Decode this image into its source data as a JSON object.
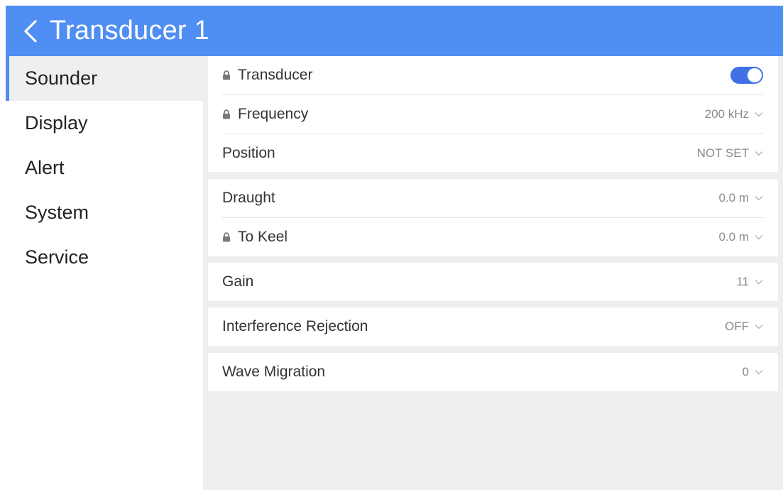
{
  "header": {
    "title": "Transducer 1",
    "back_icon": "chevron-left-icon"
  },
  "colors": {
    "accent": "#4f8ef3",
    "toggle_on": "#4271e6",
    "panel_bg": "#eeeeee"
  },
  "sidebar": {
    "items": [
      {
        "label": "Sounder",
        "active": true
      },
      {
        "label": "Display",
        "active": false
      },
      {
        "label": "Alert",
        "active": false
      },
      {
        "label": "System",
        "active": false
      },
      {
        "label": "Service",
        "active": false
      }
    ]
  },
  "settings": {
    "transducer": {
      "label": "Transducer",
      "locked": true,
      "enabled": true
    },
    "frequency": {
      "label": "Frequency",
      "locked": true,
      "value": "200 kHz"
    },
    "position": {
      "label": "Position",
      "locked": false,
      "value": "NOT SET"
    },
    "draught": {
      "label": "Draught",
      "locked": false,
      "value": "0.0 m"
    },
    "to_keel": {
      "label": "To Keel",
      "locked": true,
      "value": "0.0 m"
    },
    "gain": {
      "label": "Gain",
      "locked": false,
      "value": "11"
    },
    "interference_rejection": {
      "label": "Interference Rejection",
      "locked": false,
      "value": "OFF"
    },
    "wave_migration": {
      "label": "Wave Migration",
      "locked": false,
      "value": "0"
    }
  }
}
